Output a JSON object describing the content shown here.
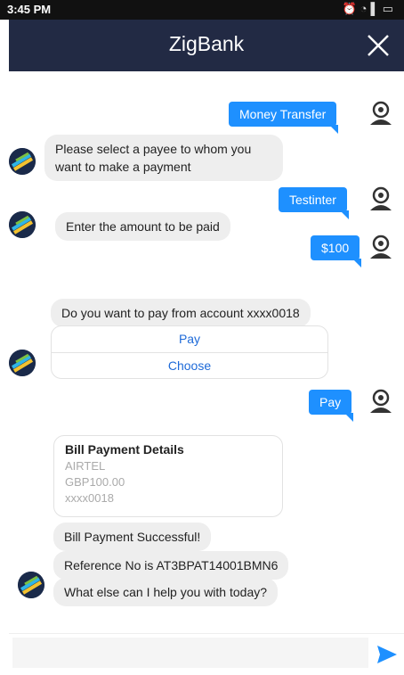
{
  "status_bar": {
    "time": "3:45 PM",
    "icons": [
      "alarm-icon",
      "wifi-icon",
      "signal-icon",
      "battery-icon"
    ]
  },
  "header": {
    "title": "ZigBank",
    "close_icon": "close-icon"
  },
  "colors": {
    "header_bg": "#222a44",
    "user_bubble": "#1e90ff",
    "bot_bubble": "#eeeeee",
    "link": "#1e6ad8",
    "send": "#1e90ff"
  },
  "messages": {
    "m1": "Money Transfer",
    "m2": "Please select a payee to whom you want to make a payment",
    "m3": "Testinter",
    "m4": "Enter the amount to be paid",
    "m5": "$100",
    "m6": "Do you want to pay from account xxxx0018",
    "options": [
      "Pay",
      "Choose"
    ],
    "m7": "Pay",
    "card": {
      "title": "Bill Payment Details",
      "lines": [
        "AIRTEL",
        "GBP100.00",
        "xxxx0018"
      ]
    },
    "m8": "Bill Payment Successful!",
    "m9": "Reference No is AT3BPAT14001BMN6",
    "m10": "What else can I help you with today?"
  },
  "composer": {
    "value": "",
    "placeholder": "",
    "send_icon": "send-icon"
  }
}
